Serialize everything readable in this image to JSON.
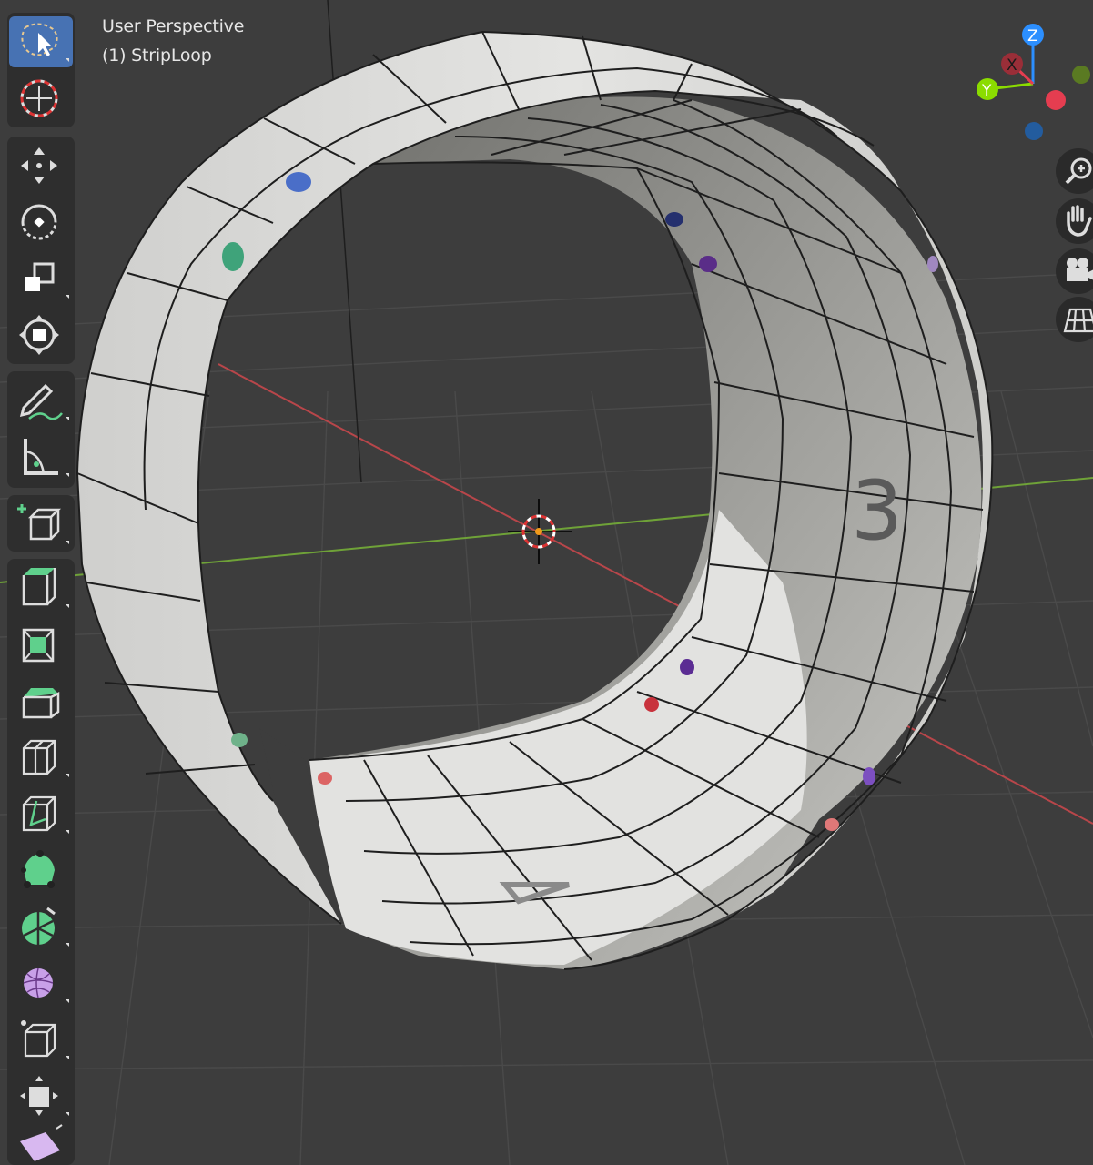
{
  "viewport": {
    "view_name": "User Perspective",
    "object_name": "(1) StripLoop",
    "mesh_label": "3"
  },
  "colors": {
    "background": "#3d3d3d",
    "grid_line": "#4a4a4a",
    "x_axis": "#b8464a",
    "y_axis": "#6fa238",
    "mesh_face": "#d5d5d3",
    "mesh_edge": "#1e1e1e",
    "active_tool": "#4772b3"
  },
  "toolbar": {
    "tools": [
      {
        "name": "select-box-tool",
        "icon": "select-box-icon",
        "active": true
      },
      {
        "name": "cursor-tool",
        "icon": "cursor-icon"
      },
      {
        "name": "move-tool",
        "icon": "move-icon"
      },
      {
        "name": "rotate-tool",
        "icon": "rotate-icon"
      },
      {
        "name": "scale-tool",
        "icon": "scale-icon"
      },
      {
        "name": "transform-tool",
        "icon": "transform-icon"
      },
      {
        "name": "annotate-tool",
        "icon": "annotate-icon"
      },
      {
        "name": "measure-tool",
        "icon": "measure-icon"
      },
      {
        "name": "add-cube-tool",
        "icon": "add-cube-icon"
      },
      {
        "name": "extrude-region-tool",
        "icon": "extrude-icon"
      },
      {
        "name": "inset-faces-tool",
        "icon": "inset-icon"
      },
      {
        "name": "bevel-tool",
        "icon": "bevel-icon"
      },
      {
        "name": "loop-cut-tool",
        "icon": "loop-cut-icon"
      },
      {
        "name": "knife-tool",
        "icon": "knife-icon"
      },
      {
        "name": "poly-build-tool",
        "icon": "poly-build-icon"
      },
      {
        "name": "spin-tool",
        "icon": "spin-icon"
      },
      {
        "name": "smooth-tool",
        "icon": "smooth-icon"
      },
      {
        "name": "edge-slide-tool",
        "icon": "edge-slide-icon"
      },
      {
        "name": "shrink-fatten-tool",
        "icon": "shrink-fatten-icon"
      },
      {
        "name": "shear-tool",
        "icon": "shear-icon"
      }
    ]
  },
  "gizmo": {
    "x_label": "X",
    "y_label": "Y",
    "z_label": "Z",
    "x_color": "#e53d50",
    "y_color": "#8bdc00",
    "z_color": "#2c8fff"
  },
  "nav_buttons": [
    {
      "name": "zoom-button",
      "icon": "zoom-icon"
    },
    {
      "name": "pan-button",
      "icon": "hand-icon"
    },
    {
      "name": "camera-view-button",
      "icon": "camera-icon"
    },
    {
      "name": "projection-toggle-button",
      "icon": "grid-icon"
    }
  ]
}
